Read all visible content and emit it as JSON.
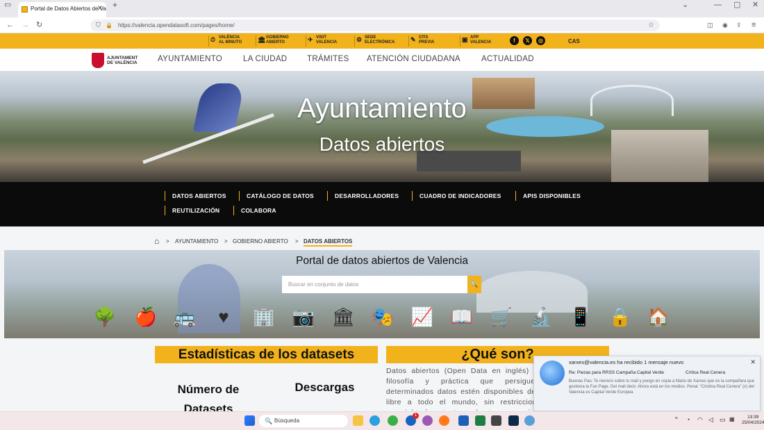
{
  "browser": {
    "tab_title": "Portal de Datos Abiertos de Valencia",
    "tab_close": "✕",
    "new_tab": "+",
    "url": "https://valencia.opendatasoft.com/pages/home/"
  },
  "topbar": {
    "links": [
      {
        "icon": "⏱",
        "line1": "VALÈNCIA",
        "line2": "AL MINUTO"
      },
      {
        "icon": "🏛",
        "line1": "GOBIERNO",
        "line2": "ABIERTO"
      },
      {
        "icon": "✈",
        "line1": "VISIT",
        "line2": "VALENCIA"
      },
      {
        "icon": "⚙",
        "line1": "SEDE",
        "line2": "ELECTRÓNICA"
      },
      {
        "icon": "✎",
        "line1": "CITA",
        "line2": "PREVIA"
      },
      {
        "icon": "▣",
        "line1": "APP",
        "line2": "VALENCIA"
      }
    ],
    "social": [
      "f",
      "𝕏",
      "◎"
    ],
    "lang": "CAS"
  },
  "nav": {
    "logo_line1": "AJUNTAMENT",
    "logo_line2": "DE VALÈNCIA",
    "items": [
      "AYUNTAMIENTO",
      "LA CIUDAD",
      "TRÁMITES",
      "ATENCIÓN CIUDADANA",
      "ACTUALIDAD"
    ]
  },
  "hero": {
    "title": "Ayuntamiento",
    "subtitle": "Datos abiertos"
  },
  "subnav": {
    "row1": [
      "DATOS ABIERTOS",
      "CATÁLOGO DE DATOS",
      "DESARROLLADORES",
      "CUADRO DE INDICADORES",
      "APIS DISPONIBLES"
    ],
    "row2": [
      "REUTILIZACIÓN",
      "COLABORA"
    ]
  },
  "breadcrumb": {
    "items": [
      "AYUNTAMIENTO",
      "GOBIERNO ABIERTO",
      "DATOS ABIERTOS"
    ],
    "separator": ">"
  },
  "portal": {
    "title": "Portal de datos abiertos de Valencia",
    "search_placeholder": "Buscar en conjunto de datos",
    "search_icon": "🔍",
    "categories": [
      "🌳",
      "🍎",
      "🚌",
      "♥",
      "🏢",
      "📷",
      "🏛",
      "🎭",
      "📈",
      "📖",
      "🛒",
      "🔬",
      "📱",
      "🔒",
      "🏠"
    ]
  },
  "stats": {
    "title": "Estadísticas de los datasets",
    "col1_line1": "Número de",
    "col1_line2": "Datasets",
    "col2": "Descargas"
  },
  "que_son": {
    "title": "¿Qué son?",
    "text": "Datos abiertos (Open Data en inglés) es una filosofía y práctica que persigue que determinados datos estén disponibles de forma libre a todo el mundo, sin restricciones de copyright, de patentes o de otros mecanismos de control. Los datos deben publicarse para que puedan ser usados y reutilizados en formatos reconocidos que faciliten su"
  },
  "notification": {
    "header": "xarxes@valencia.es ha recibido 1 mensaje nuevo",
    "close": "✕",
    "sender": "Re: Piezas para RRSS Campaña Capital Verde",
    "subject": "Crítica Real Cenera",
    "body": "Buenas Pau: Te reenvío sobre tu mail y pongo en copia a Mario de Xarxes que es la compañera que gestiona la Fan Page. Del mail decir. Ahora está en los medios. Penal: “Cristina Real Cenera” (x) del Valencia es Capital Verde Europea"
  },
  "taskbar": {
    "search_text": "Búsqueda",
    "search_icon": "🔍",
    "time": "13:39",
    "date": "25/04/2024",
    "badge": "1"
  }
}
